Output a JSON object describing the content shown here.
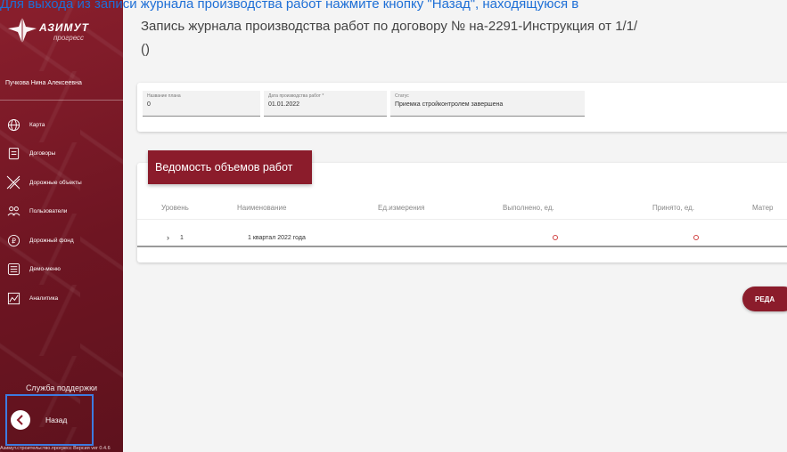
{
  "instruction": "Для выхода из записи журнала производства работ нажмите кнопку \"Назад\", находящуюся в",
  "sidebar": {
    "logo_text": "АЗИМУТ",
    "logo_sub": "прогресс",
    "user_name": "Пучкова Нина Алексеевна",
    "items": [
      {
        "label": "Карта",
        "icon": "globe-icon"
      },
      {
        "label": "Договоры",
        "icon": "document-icon"
      },
      {
        "label": "Дорожные объекты",
        "icon": "road-objects-icon"
      },
      {
        "label": "Пользователи",
        "icon": "users-icon"
      },
      {
        "label": "Дорожный фонд",
        "icon": "coin-icon"
      },
      {
        "label": "Демо-меню",
        "icon": "list-icon"
      },
      {
        "label": "Аналитика",
        "icon": "analytics-icon"
      }
    ],
    "support": "Служба поддержки",
    "back": "Назад",
    "version": "Азимут.строительство.прогресс Версия ver 0.4.6"
  },
  "main": {
    "title_line1": "Запись журнала производства работ по договору № на-2291-Инструкция от 1/1/",
    "title_line2": "()",
    "form": {
      "plan_name_label": "Название плана",
      "plan_name_value": "0",
      "date_label": "Дата производства работ *",
      "date_value": "01.01.2022",
      "status_label": "Статус",
      "status_value": "Приемка стройконтролем завершена"
    },
    "table": {
      "tab_title": "Ведомость объемов работ",
      "columns": [
        "Уровень",
        "Наименование",
        "Ед.измерения",
        "Выполнено, ед.",
        "Принято, ед.",
        "Матер"
      ],
      "rows": [
        {
          "level": "1",
          "name": "1 квартал 2022 года",
          "unit": "",
          "done": "0",
          "accepted": "0"
        }
      ]
    },
    "edit_button": "РЕДА"
  },
  "colors": {
    "brand": "#8b1c2b",
    "instruction": "#1e6fd6",
    "highlight_border": "#3d7be0"
  }
}
